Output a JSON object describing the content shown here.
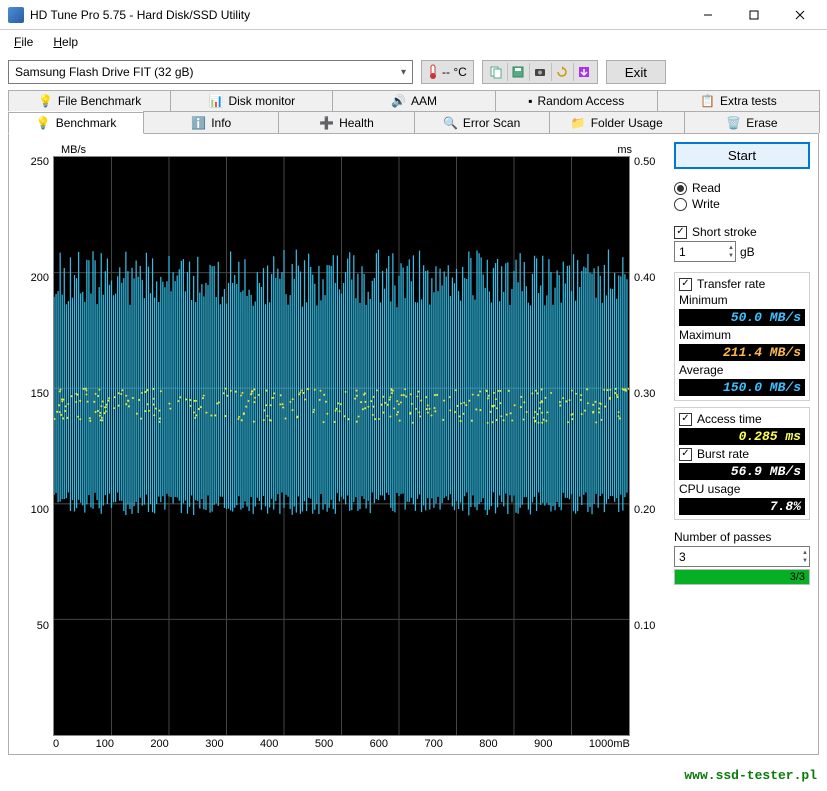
{
  "window": {
    "title": "HD Tune Pro 5.75 - Hard Disk/SSD Utility"
  },
  "menu": {
    "file": "File",
    "help": "Help"
  },
  "toolbar": {
    "drive": "Samsung Flash Drive FIT (32 gB)",
    "temp": "-- °C",
    "exit_label": "Exit"
  },
  "tabs_top": [
    {
      "id": "file-benchmark",
      "label": "File Benchmark"
    },
    {
      "id": "disk-monitor",
      "label": "Disk monitor"
    },
    {
      "id": "aam",
      "label": "AAM"
    },
    {
      "id": "random-access",
      "label": "Random Access"
    },
    {
      "id": "extra-tests",
      "label": "Extra tests"
    }
  ],
  "tabs_bottom": [
    {
      "id": "benchmark",
      "label": "Benchmark"
    },
    {
      "id": "info",
      "label": "Info"
    },
    {
      "id": "health",
      "label": "Health"
    },
    {
      "id": "error-scan",
      "label": "Error Scan"
    },
    {
      "id": "folder-usage",
      "label": "Folder Usage"
    },
    {
      "id": "erase",
      "label": "Erase"
    }
  ],
  "sidebar": {
    "start_label": "Start",
    "read_label": "Read",
    "write_label": "Write",
    "short_stroke_label": "Short stroke",
    "short_stroke_value": "1",
    "short_stroke_unit": "gB",
    "transfer_rate_label": "Transfer rate",
    "min_label": "Minimum",
    "min_value": "50.0 MB/s",
    "max_label": "Maximum",
    "max_value": "211.4 MB/s",
    "avg_label": "Average",
    "avg_value": "150.0 MB/s",
    "access_time_label": "Access time",
    "access_time_value": "0.285 ms",
    "burst_rate_label": "Burst rate",
    "burst_rate_value": "56.9 MB/s",
    "cpu_label": "CPU usage",
    "cpu_value": "7.8%",
    "passes_label": "Number of passes",
    "passes_value": "3",
    "progress_text": "3/3"
  },
  "chart": {
    "y_left_label": "MB/s",
    "y_right_label": "ms",
    "y_left_ticks": [
      "250",
      "200",
      "150",
      "100",
      "50",
      ""
    ],
    "y_right_ticks": [
      "0.50",
      "0.40",
      "0.30",
      "0.20",
      "0.10",
      ""
    ],
    "x_ticks": [
      "0",
      "100",
      "200",
      "300",
      "400",
      "500",
      "600",
      "700",
      "800",
      "900",
      "1000mB"
    ]
  },
  "chart_data": {
    "type": "line",
    "title": "",
    "xlabel": "mB",
    "ylabel": "MB/s",
    "y2label": "ms",
    "xlim": [
      0,
      1000
    ],
    "ylim_left": [
      0,
      250
    ],
    "ylim_right": [
      0,
      0.5
    ],
    "series": [
      {
        "name": "Transfer rate (MB/s)",
        "axis": "left",
        "style": "spikes",
        "color": "#33bde6",
        "value_range": [
          100,
          210
        ],
        "avg": 150,
        "x": [
          0,
          1000
        ],
        "note": "dense vertical oscillation between ~100 and ~210 MB/s across full range; avg ≈150"
      },
      {
        "name": "Access time (ms)",
        "axis": "right",
        "style": "scatter",
        "color": "#e6e63e",
        "value_range": [
          0.27,
          0.3
        ],
        "avg": 0.285,
        "x": [
          0,
          1000
        ],
        "note": "scatter band clustered around 0.285 ms"
      }
    ]
  },
  "watermark": "www.ssd-tester.pl"
}
